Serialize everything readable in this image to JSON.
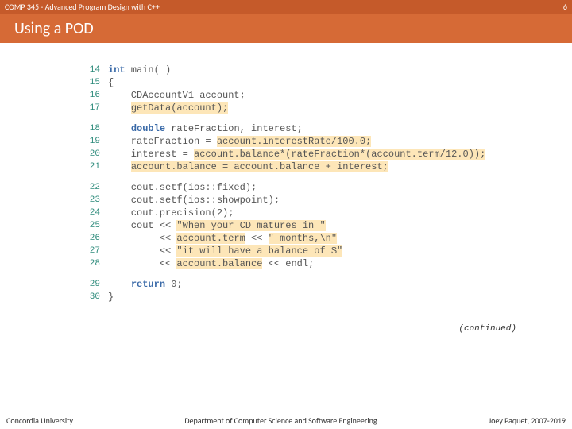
{
  "top": {
    "course": "COMP 345 - Advanced Program Design with C++",
    "pagenum": "6"
  },
  "title": "Using a POD",
  "blocks": [
    [
      {
        "ln": "14",
        "kw": "int",
        "pre": " main( )"
      },
      {
        "ln": "15",
        "pre": "{"
      },
      {
        "ln": "16",
        "pre": "    CDAccountV1 account;"
      },
      {
        "ln": "17",
        "pre": "    ",
        "hl": "getData(account);"
      }
    ],
    [
      {
        "ln": "18",
        "pre": "    ",
        "kw": "double",
        "post": " rateFraction, interest;"
      },
      {
        "ln": "19",
        "pre": "    rateFraction = ",
        "hl": "account.interestRate/100.0;"
      },
      {
        "ln": "20",
        "pre": "    interest = ",
        "hl": "account.balance*(rateFraction*(account.term/12.0));"
      },
      {
        "ln": "21",
        "pre": "    ",
        "hl": "account.balance = account.balance + interest;"
      }
    ],
    [
      {
        "ln": "22",
        "pre": "    cout.setf(ios::fixed);"
      },
      {
        "ln": "23",
        "pre": "    cout.setf(ios::showpoint);"
      },
      {
        "ln": "24",
        "pre": "    cout.precision(2);"
      },
      {
        "ln": "25",
        "pre": "    cout << ",
        "hl": "\"When your CD matures in \""
      },
      {
        "ln": "26",
        "pre": "         << ",
        "hl": "account.term",
        "post": " << ",
        "hl2": "\" months,\\n\""
      },
      {
        "ln": "27",
        "pre": "         << ",
        "hl": "\"it will have a balance of $\""
      },
      {
        "ln": "28",
        "pre": "         << ",
        "hl": "account.balance",
        "post": " << endl;"
      }
    ],
    [
      {
        "ln": "29",
        "pre": "    ",
        "kw": "return",
        "post": " 0;"
      },
      {
        "ln": "30",
        "pre": "}"
      }
    ]
  ],
  "continued": "(continued)",
  "footer": {
    "left": "Concordia University",
    "center": "Department of Computer Science and Software Engineering",
    "right": "Joey Paquet, 2007-2019"
  }
}
